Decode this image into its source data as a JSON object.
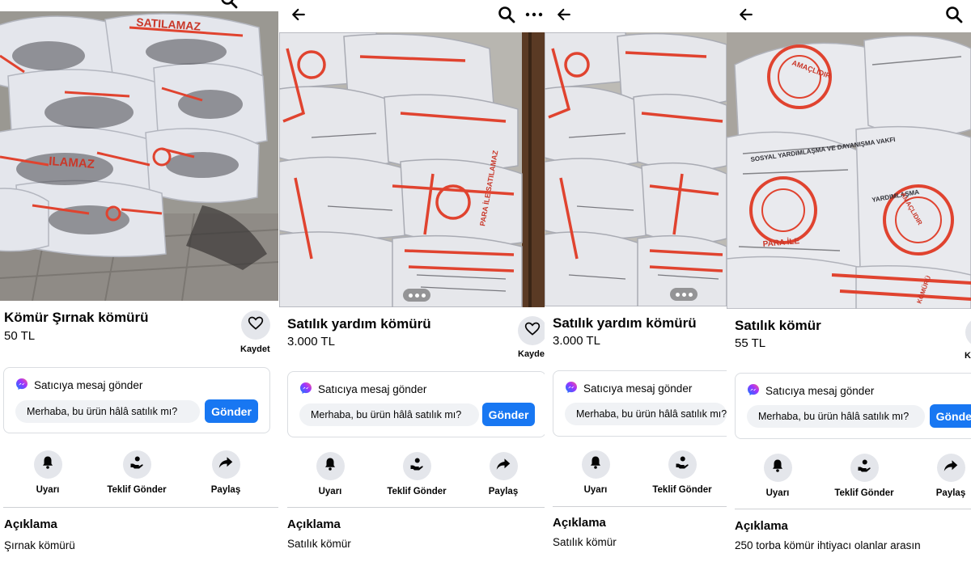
{
  "screens": [
    {
      "title": "Kömür  Şırnak kömürü",
      "price": "50 TL",
      "save_label": "Kaydet",
      "message_header": "Satıcıya mesaj gönder",
      "message_text": "Merhaba, bu ürün hâlâ satılık mı?",
      "send_label": "Gönder",
      "actions": [
        "Uyarı",
        "Teklif Gönder",
        "Paylaş"
      ],
      "description_heading": "Açıklama",
      "description_text": "Şırnak kömürü",
      "photo_texts": [
        "SATILAMAZ",
        "ILAMAZ"
      ]
    },
    {
      "title": "Satılık yardım kömürü",
      "price": "3.000 TL",
      "save_label": "Kaydet",
      "message_header": "Satıcıya mesaj gönder",
      "message_text": "Merhaba, bu ürün hâlâ satılık mı?",
      "send_label": "Gönder",
      "actions": [
        "Uyarı",
        "Teklif Gönder",
        "Paylaş"
      ],
      "description_heading": "Açıklama",
      "description_text": "Satılık kömür",
      "photo_texts": [
        "PARA İLE SATILAMAZ"
      ]
    },
    {
      "title": "Satılık yardım kömürü",
      "price": "3.000 TL",
      "message_header": "Satıcıya mesaj gönder",
      "message_text": "Merhaba, bu ürün hâlâ satılık mı?",
      "actions": [
        "Uyarı",
        "Teklif Gönder"
      ],
      "description_heading": "Açıklama",
      "description_text": "Satılık kömür"
    },
    {
      "title": "Satılık kömür",
      "price": "55 TL",
      "save_label": "K",
      "message_header": "Satıcıya mesaj gönder",
      "message_text": "Merhaba, bu ürün hâlâ satılık mı?",
      "send_label": "Gönder",
      "actions": [
        "Uyarı",
        "Teklif Gönder",
        "Paylaş"
      ],
      "description_heading": "Açıklama",
      "description_text": "250 torba kömür ihtiyacı olanlar arasın",
      "photo_texts": [
        "SOSYAL YARDIMLAŞMA VE DAYANIŞMA VAKFI",
        "AMAÇLIDIR",
        "PARA İLE",
        "YARDIMLAŞMA",
        "AMAÇLIDIR",
        "KÖMÜRÜ"
      ]
    }
  ],
  "icons": {
    "back": "arrow-left-icon",
    "search": "search-icon",
    "more": "more-dots-icon",
    "heart": "heart-icon",
    "messenger": "messenger-icon",
    "bell": "bell-icon",
    "offer": "hand-offer-icon",
    "share": "share-arrow-icon"
  },
  "colors": {
    "send_button": "#1877f2",
    "circle_bg": "#e4e6eb",
    "input_bg": "#f0f2f5",
    "bag_stripe": "#e0432f"
  }
}
